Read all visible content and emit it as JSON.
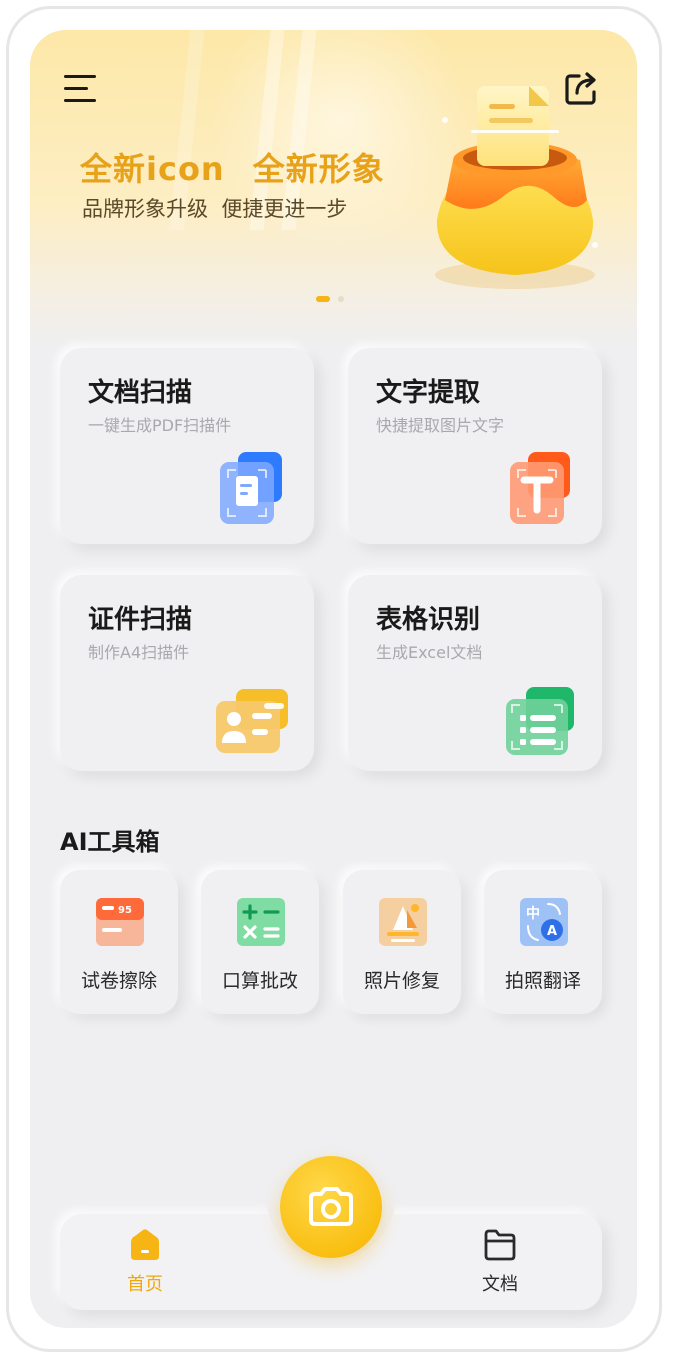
{
  "header": {
    "menu_icon": "menu-icon",
    "share_icon": "share-icon"
  },
  "banner": {
    "title_part1": "全新icon",
    "title_part2": "全新形象",
    "subtitle": "品牌形象升级  便捷更进一步",
    "slide_count": 2,
    "active_slide": 1
  },
  "features": [
    {
      "title": "文档扫描",
      "desc": "一键生成PDF扫描件",
      "icon": "document-scan-icon"
    },
    {
      "title": "文字提取",
      "desc": "快捷提取图片文字",
      "icon": "text-extract-icon"
    },
    {
      "title": "证件扫描",
      "desc": "制作A4扫描件",
      "icon": "id-card-scan-icon"
    },
    {
      "title": "表格识别",
      "desc": "生成Excel文档",
      "icon": "table-recognize-icon"
    }
  ],
  "ai_toolbox": {
    "title": "AI工具箱",
    "items": [
      {
        "label": "试卷擦除",
        "icon": "exam-erase-icon"
      },
      {
        "label": "口算批改",
        "icon": "calculator-icon"
      },
      {
        "label": "照片修复",
        "icon": "photo-repair-icon"
      },
      {
        "label": "拍照翻译",
        "icon": "translate-icon"
      }
    ]
  },
  "bottom_nav": {
    "home_label": "首页",
    "docs_label": "文档",
    "camera_icon": "camera-icon",
    "active": "home"
  },
  "colors": {
    "accent": "#f6b514",
    "banner_title": "#e8a21a",
    "background": "#efeff1"
  }
}
